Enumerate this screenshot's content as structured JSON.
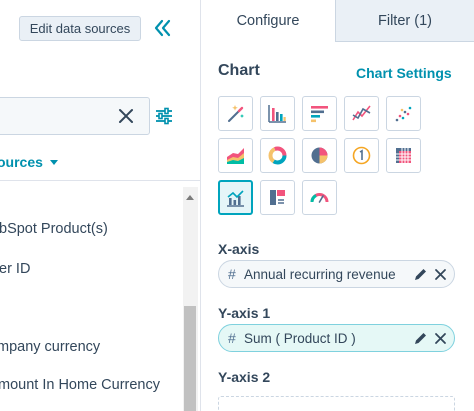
{
  "left_panel": {
    "edit_sources_label": "Edit data sources",
    "collapse_icon": "double-chevron-left-icon",
    "search": {
      "value": "",
      "placeholder": ""
    },
    "sources_link": "ources",
    "properties": [
      "bSpot Product(s)",
      "er ID",
      "mpany currency",
      "mount In Home Currency"
    ]
  },
  "tabs": [
    {
      "label": "Configure",
      "active": true
    },
    {
      "label": "Filter (1)",
      "active": false
    }
  ],
  "chart_section": {
    "heading": "Chart",
    "settings_link": "Chart Settings",
    "types": [
      {
        "icon": "magic-wand-icon",
        "selected": false
      },
      {
        "icon": "vertical-bar-chart-icon",
        "selected": false
      },
      {
        "icon": "horizontal-bar-chart-icon",
        "selected": false
      },
      {
        "icon": "line-chart-icon",
        "selected": false
      },
      {
        "icon": "scatter-chart-icon",
        "selected": false
      },
      {
        "icon": "area-chart-icon",
        "selected": false
      },
      {
        "icon": "donut-chart-icon",
        "selected": false
      },
      {
        "icon": "pie-chart-icon",
        "selected": false
      },
      {
        "icon": "single-value-icon",
        "selected": false
      },
      {
        "icon": "pivot-table-icon",
        "selected": false
      },
      {
        "icon": "combination-chart-icon",
        "selected": true
      },
      {
        "icon": "table-icon",
        "selected": false
      },
      {
        "icon": "gauge-icon",
        "selected": false
      }
    ]
  },
  "axes": {
    "x_label": "X-axis",
    "x_field": "Annual recurring revenue",
    "y1_label": "Y-axis 1",
    "y1_field": "Sum ( Product ID )",
    "y2_label": "Y-axis 2",
    "field_type_symbol": "#"
  },
  "colors": {
    "accent": "#00a4bd",
    "link": "#0091ae",
    "text": "#33475b",
    "border": "#cbd6e2"
  }
}
